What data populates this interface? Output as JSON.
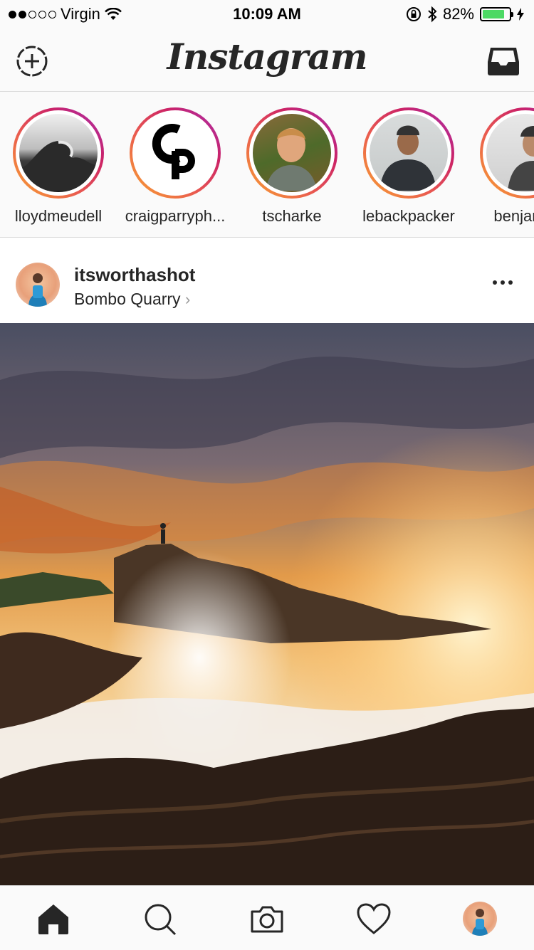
{
  "status_bar": {
    "carrier": "Virgin",
    "time": "10:09 AM",
    "battery_percent": "82%",
    "battery_level": 0.82,
    "signal_bars_filled": 2,
    "signal_bars_total": 5
  },
  "header": {
    "logo": "Instagram",
    "new_story_icon": "add-story-icon",
    "inbox_icon": "inbox-icon"
  },
  "stories": [
    {
      "username": "lloydmeudell"
    },
    {
      "username": "craigparryph..."
    },
    {
      "username": "tscharke"
    },
    {
      "username": "lebackpacker"
    },
    {
      "username": "benjamin"
    }
  ],
  "post": {
    "username": "itsworthashot",
    "location": "Bombo Quarry",
    "location_chevron": "›"
  },
  "tabbar": {
    "items": [
      "home-icon",
      "search-icon",
      "camera-icon",
      "heart-icon",
      "profile-avatar"
    ]
  },
  "colors": {
    "story_ring_start": "#f9a530",
    "story_ring_end": "#a52fb4",
    "battery_fill": "#4cd964",
    "text_primary": "#262626"
  }
}
